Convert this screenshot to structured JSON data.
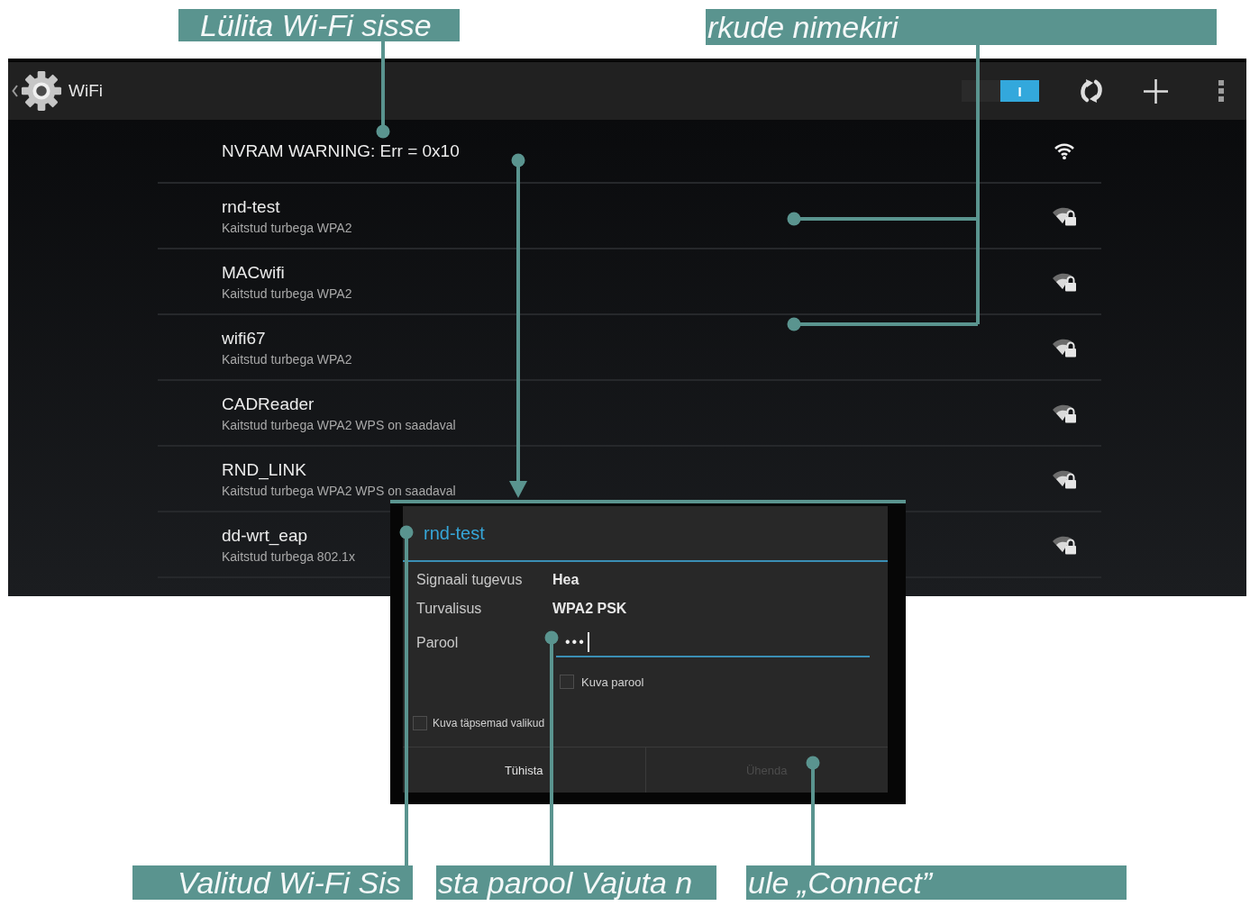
{
  "callouts": {
    "top": [
      "Lülita Wi-Fi sisse",
      "rkude nimekiri"
    ],
    "bottom": [
      "Valitud Wi-Fi Sis",
      "sta parool Vajuta n",
      "ule „Connect”"
    ]
  },
  "action_bar": {
    "title": "WiFi",
    "toggle": {
      "label": "I",
      "on": true
    }
  },
  "networks": [
    {
      "name": "NVRAM WARNING: Err = 0x10",
      "secured": false
    },
    {
      "name": "rnd-test",
      "status": "Kaitstud turbega WPA2",
      "secured": true
    },
    {
      "name": "MACwifi",
      "status": "Kaitstud turbega WPA2",
      "secured": true
    },
    {
      "name": "wifi67",
      "status": "Kaitstud turbega WPA2",
      "secured": true
    },
    {
      "name": "CADReader",
      "status": "Kaitstud turbega WPA2 WPS on saadaval",
      "secured": true
    },
    {
      "name": "RND_LINK",
      "status": "Kaitstud turbega WPA2 WPS on saadaval",
      "secured": true
    },
    {
      "name": "dd-wrt_eap",
      "status": "Kaitstud turbega 802.1x",
      "secured": true
    }
  ],
  "dialog": {
    "title": "rnd-test",
    "details": [
      {
        "label": "Signaali tugevus",
        "value": "Hea"
      },
      {
        "label": "Turvalisus",
        "value": "WPA2 PSK"
      }
    ],
    "password": {
      "label": "Parool",
      "value": "•••"
    },
    "show_password": {
      "label": "Kuva parool",
      "checked": false
    },
    "advanced": {
      "label": "Kuva täpsemad valikud",
      "checked": false
    },
    "buttons": [
      {
        "label": "Tühista",
        "disabled": false
      },
      {
        "label": "Ühenda",
        "disabled": true
      }
    ]
  }
}
